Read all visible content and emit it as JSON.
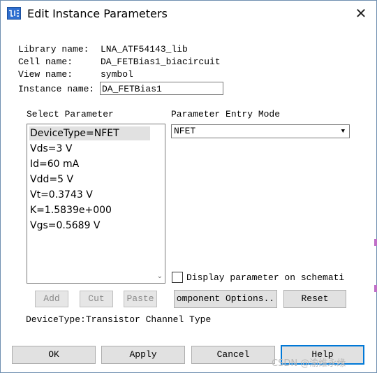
{
  "window": {
    "title": "Edit Instance Parameters",
    "close_glyph": "✕",
    "app_icon": "schematic-app-icon"
  },
  "info": {
    "library_label": "Library name:",
    "library_value": "LNA_ATF54143_lib",
    "cell_label": "Cell name:",
    "cell_value": "DA_FETBias1_biacircuit",
    "view_label": "View name:",
    "view_value": "symbol",
    "instance_label": "Instance name:",
    "instance_value": "DA_FETBias1"
  },
  "params": {
    "header": "Select Parameter",
    "items": [
      "DeviceType=NFET",
      "Vds=3 V",
      "Id=60 mA",
      "Vdd=5 V",
      "Vt=0.3743 V",
      "K=1.5839e+000",
      "Vgs=0.5689 V"
    ],
    "selected_index": 0,
    "scroll_down_glyph": "⌄"
  },
  "entry": {
    "header": "Parameter Entry Mode",
    "selected_value": "NFET",
    "dropdown_glyph": "▼"
  },
  "display_checkbox": {
    "label": "Display parameter on schemati",
    "checked": false
  },
  "buttons": {
    "add": "Add",
    "cut": "Cut",
    "paste": "Paste",
    "component_options": "omponent Options..",
    "reset": "Reset",
    "ok": "OK",
    "apply": "Apply",
    "cancel": "Cancel",
    "help": "Help"
  },
  "description": "DeviceType:Transistor Channel Type",
  "watermark": "CSDN @渝维永缘",
  "colors": {
    "focus_border": "#0078d7",
    "button_face": "#e1e1e1",
    "selection_bg": "#e1e1e1"
  }
}
